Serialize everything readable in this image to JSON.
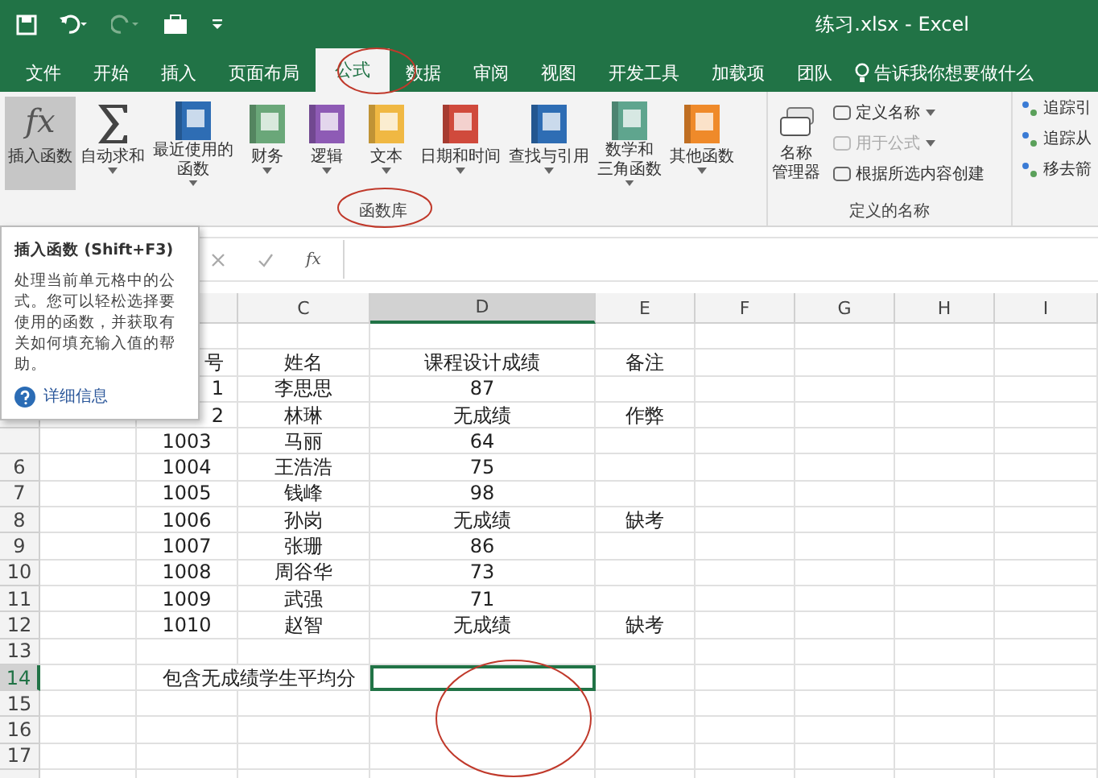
{
  "title_bar": {
    "title": "练习.xlsx  -  Excel"
  },
  "tabs": [
    {
      "label": "文件",
      "selected": false
    },
    {
      "label": "开始",
      "selected": false
    },
    {
      "label": "插入",
      "selected": false
    },
    {
      "label": "页面布局",
      "selected": false
    },
    {
      "label": "公式",
      "selected": true
    },
    {
      "label": "数据",
      "selected": false
    },
    {
      "label": "审阅",
      "selected": false
    },
    {
      "label": "视图",
      "selected": false
    },
    {
      "label": "开发工具",
      "selected": false
    },
    {
      "label": "加载项",
      "selected": false
    },
    {
      "label": "团队",
      "selected": false
    }
  ],
  "tell_me": "告诉我你想要做什么",
  "function_library": {
    "label": "函数库",
    "buttons": [
      {
        "lines": [
          "插入函数"
        ],
        "kind": "fx",
        "icon_text": "fx",
        "dropdown": false,
        "selected": true
      },
      {
        "lines": [
          "自动求和"
        ],
        "kind": "sum",
        "dropdown": true,
        "selected": false
      },
      {
        "lines": [
          "最近使用的",
          "函数"
        ],
        "kind": "star",
        "dropdown": true,
        "selected": false
      },
      {
        "lines": [
          "财务"
        ],
        "kind": "finance",
        "dropdown": true,
        "selected": false
      },
      {
        "lines": [
          "逻辑"
        ],
        "kind": "logic",
        "dropdown": true,
        "selected": false
      },
      {
        "lines": [
          "文本"
        ],
        "kind": "text",
        "dropdown": true,
        "selected": false
      },
      {
        "lines": [
          "日期和时间"
        ],
        "kind": "date",
        "dropdown": true,
        "selected": false
      },
      {
        "lines": [
          "查找与引用"
        ],
        "kind": "lookup",
        "dropdown": true,
        "selected": false
      },
      {
        "lines": [
          "数学和",
          "三角函数"
        ],
        "kind": "math",
        "dropdown": true,
        "selected": false
      },
      {
        "lines": [
          "其他函数"
        ],
        "kind": "more",
        "dropdown": true,
        "selected": false
      }
    ]
  },
  "defined_names": {
    "label": "定义的名称",
    "manager": [
      "名称",
      "管理器"
    ],
    "items": [
      {
        "label": "定义名称",
        "dropdown": true,
        "disabled": false
      },
      {
        "label": "用于公式",
        "dropdown": true,
        "disabled": true
      },
      {
        "label": "根据所选内容创建",
        "dropdown": false,
        "disabled": false
      }
    ]
  },
  "auditing": {
    "items": [
      "追踪引",
      "追踪从",
      "移去箭"
    ]
  },
  "formula_bar": {
    "fx": "fx"
  },
  "tooltip": {
    "title": "插入函数 (Shift+F3)",
    "body": "处理当前单元格中的公式。您可以轻松选择要使用的函数，并获取有关如何填充输入值的帮助。",
    "link": "详细信息"
  },
  "columns": [
    {
      "label": "C",
      "selected": false
    },
    {
      "label": "D",
      "selected": true
    },
    {
      "label": "E",
      "selected": false
    },
    {
      "label": "F",
      "selected": false
    },
    {
      "label": "G",
      "selected": false
    },
    {
      "label": "H",
      "selected": false
    },
    {
      "label": "I",
      "selected": false
    }
  ],
  "rows": [
    {},
    {
      "b": "号",
      "b_partial": true,
      "c": "姓名",
      "d": "课程设计成绩",
      "e": "备注"
    },
    {
      "b": "1",
      "b_partial": true,
      "c": "李思思",
      "d": "87"
    },
    {
      "b": "2",
      "b_partial": true,
      "c": "林琳",
      "d": "无成绩",
      "e": "作弊"
    },
    {
      "b": "1003",
      "c": "马丽",
      "d": "64"
    },
    {
      "number": "6",
      "selected": false,
      "b": "1004",
      "c": "王浩浩",
      "d": "75"
    },
    {
      "number": "7",
      "selected": false,
      "b": "1005",
      "c": "钱峰",
      "d": "98"
    },
    {
      "number": "8",
      "selected": false,
      "b": "1006",
      "c": "孙岗",
      "d": "无成绩",
      "e": "缺考"
    },
    {
      "number": "9",
      "selected": false,
      "b": "1007",
      "c": "张珊",
      "d": "86"
    },
    {
      "number": "10",
      "selected": false,
      "b": "1008",
      "c": "周谷华",
      "d": "73"
    },
    {
      "number": "11",
      "selected": false,
      "b": "1009",
      "c": "武强",
      "d": "71"
    },
    {
      "number": "12",
      "selected": false,
      "b": "1010",
      "c": "赵智",
      "d": "无成绩",
      "e": "缺考"
    },
    {
      "number": "13",
      "selected": false
    },
    {
      "number": "14",
      "selected": true,
      "label": "包含无成绩学生平均分",
      "d_active": true
    },
    {
      "number": "15",
      "selected": false
    },
    {
      "number": "16",
      "selected": false
    },
    {
      "number": "17",
      "selected": false
    },
    {}
  ]
}
